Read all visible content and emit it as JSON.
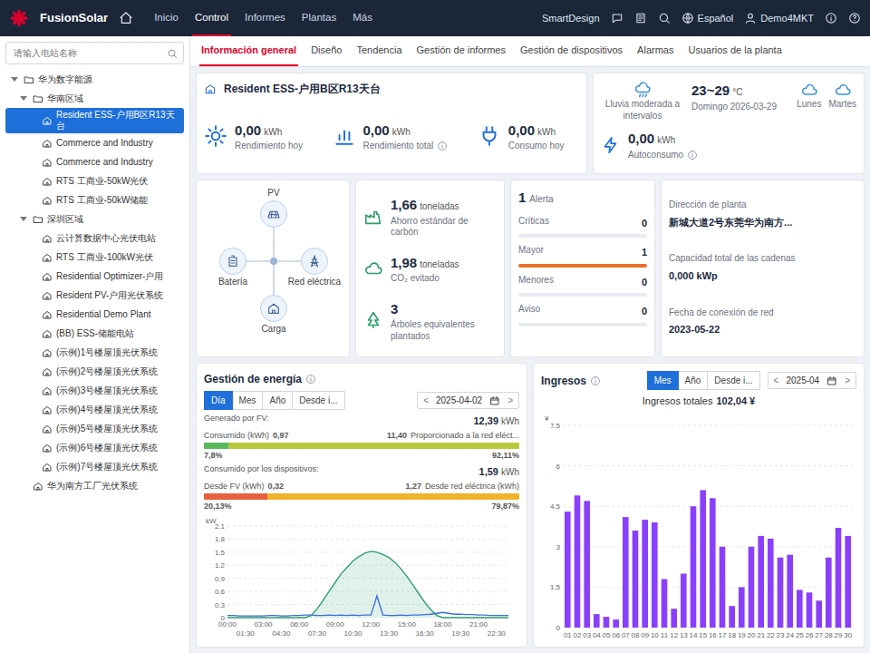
{
  "topbar": {
    "brand": "FusionSolar",
    "menu": [
      {
        "label": "Inicio",
        "selected": false
      },
      {
        "label": "Control",
        "selected": true
      },
      {
        "label": "Informes",
        "selected": false
      },
      {
        "label": "Plantas",
        "selected": false
      },
      {
        "label": "Más",
        "selected": false
      }
    ],
    "smartdesign": "SmartDesign",
    "language": "Español",
    "user": "Demo4MKT"
  },
  "sidebar": {
    "search_placeholder": "请输入电站名称",
    "items": [
      {
        "label": "华为数字能源",
        "depth": 0,
        "kind": "group",
        "expanded": true,
        "selected": false
      },
      {
        "label": "华南区域",
        "depth": 1,
        "kind": "group",
        "expanded": true,
        "selected": false
      },
      {
        "label": "Resident ESS-户用B区R13天台",
        "depth": 2,
        "kind": "plant",
        "selected": true
      },
      {
        "label": "Commerce and Industry",
        "depth": 2,
        "kind": "plant",
        "selected": false
      },
      {
        "label": "Commerce and Industry",
        "depth": 2,
        "kind": "plant",
        "selected": false
      },
      {
        "label": "RTS 工商业-50kW光伏",
        "depth": 2,
        "kind": "plant",
        "selected": false
      },
      {
        "label": "RTS 工商业-50kW储能",
        "depth": 2,
        "kind": "plant",
        "selected": false
      },
      {
        "label": "深圳区域",
        "depth": 1,
        "kind": "group",
        "expanded": true,
        "selected": false
      },
      {
        "label": "云计算数据中心光伏电站",
        "depth": 2,
        "kind": "plant",
        "selected": false
      },
      {
        "label": "RTS 工商业-100kW光伏",
        "depth": 2,
        "kind": "plant",
        "selected": false
      },
      {
        "label": "Residential Optimizer-户用",
        "depth": 2,
        "kind": "plant",
        "selected": false
      },
      {
        "label": "Resident PV-户用光伏系统",
        "depth": 2,
        "kind": "plant",
        "selected": false
      },
      {
        "label": "Residential Demo Plant",
        "depth": 2,
        "kind": "plant",
        "selected": false
      },
      {
        "label": "(BB) ESS-储能电站",
        "depth": 2,
        "kind": "plant",
        "selected": false
      },
      {
        "label": "(示例)1号楼屋顶光伏系统",
        "depth": 2,
        "kind": "plant",
        "selected": false
      },
      {
        "label": "(示例)2号楼屋顶光伏系统",
        "depth": 2,
        "kind": "plant",
        "selected": false
      },
      {
        "label": "(示例)3号楼屋顶光伏系统",
        "depth": 2,
        "kind": "plant",
        "selected": false
      },
      {
        "label": "(示例)4号楼屋顶光伏系统",
        "depth": 2,
        "kind": "plant",
        "selected": false
      },
      {
        "label": "(示例)5号楼屋顶光伏系统",
        "depth": 2,
        "kind": "plant",
        "selected": false
      },
      {
        "label": "(示例)6号楼屋顶光伏系统",
        "depth": 2,
        "kind": "plant",
        "selected": false
      },
      {
        "label": "(示例)7号楼屋顶光伏系统",
        "depth": 2,
        "kind": "plant",
        "selected": false
      },
      {
        "label": "华为南方工厂光伏系统",
        "depth": 1,
        "kind": "plant",
        "selected": false
      }
    ]
  },
  "tabs": [
    {
      "label": "Información general",
      "selected": true
    },
    {
      "label": "Diseño",
      "selected": false
    },
    {
      "label": "Tendencia",
      "selected": false
    },
    {
      "label": "Gestión de informes",
      "selected": false
    },
    {
      "label": "Gestión de dispositivos",
      "selected": false
    },
    {
      "label": "Alarmas",
      "selected": false
    },
    {
      "label": "Usuarios de la planta",
      "selected": false
    }
  ],
  "plant": {
    "name": "Resident ESS-户用B区R13天台",
    "kpis": [
      {
        "value": "0,00",
        "unit": "kWh",
        "label": "Rendimiento hoy"
      },
      {
        "value": "0,00",
        "unit": "kWh",
        "label": "Rendimiento total"
      },
      {
        "value": "0,00",
        "unit": "kWh",
        "label": "Consumo hoy"
      }
    ]
  },
  "weather": {
    "description": "Lluvia moderada a intervalos",
    "temperature": "23~29",
    "temperature_unit": "°C",
    "date": "Domingo 2026-03-29",
    "forecast": [
      "Lunes",
      "Martes"
    ],
    "self_consumption": {
      "value": "0,00",
      "unit": "kWh",
      "label": "Autoconsumo"
    }
  },
  "flow": {
    "nodes": [
      "PV",
      "Batería",
      "Red eléctrica",
      "Carga"
    ]
  },
  "environment": [
    {
      "value": "1,66",
      "unit": "toneladas",
      "label": "Ahorro estándar de carbón"
    },
    {
      "value": "1,98",
      "unit": "toneladas",
      "label": "CO₂ evitado"
    },
    {
      "value": "3",
      "unit": "",
      "label": "Árboles equivalentes plantados"
    }
  ],
  "alarms": {
    "total": "1",
    "label": "Alerta",
    "levels": [
      {
        "label": "Críticas",
        "count": "0",
        "level": 0,
        "color": "#e02b2b"
      },
      {
        "label": "Mayor",
        "count": "1",
        "level": 1,
        "color": "#e8702a"
      },
      {
        "label": "Menores",
        "count": "0",
        "level": 0,
        "color": "#f5b400"
      },
      {
        "label": "Aviso",
        "count": "0",
        "level": 0,
        "color": "#3b82f6"
      }
    ]
  },
  "plant_info": [
    {
      "label": "Dirección de planta",
      "value": "新城大道2号东莞华为南方..."
    },
    {
      "label": "Capacidad total de las cadenas",
      "value": "0,000 kWp"
    },
    {
      "label": "Fecha de conexión de red",
      "value": "2023-05-22"
    }
  ],
  "energy": {
    "title": "Gestión de energía",
    "periods": [
      {
        "label": "Día",
        "selected": true
      },
      {
        "label": "Mes",
        "selected": false
      },
      {
        "label": "Año",
        "selected": false
      },
      {
        "label": "Desde i...",
        "selected": false
      }
    ],
    "picker": {
      "prev": "<",
      "date": "2025-04-02",
      "next": ">"
    },
    "sections": [
      {
        "label": "Generado por FV:",
        "value": "12,39",
        "unit": "kWh",
        "left_label": "Consumido (kWh)",
        "left_value": "0,97",
        "right_label": "Proporcionado a la red eléct...",
        "right_value": "11,40",
        "segments": [
          {
            "text": "7,8%",
            "level": 0.0787,
            "color": "#5cb85c"
          },
          {
            "text": "92,11%",
            "level": 0.9211,
            "color": "#b7c93b"
          }
        ]
      },
      {
        "label": "Consumido por los dispositivos:",
        "value": "1,59",
        "unit": "kWh",
        "left_label": "Desde FV (kWh)",
        "left_value": "0,32",
        "right_label": "Desde red eléctrica (kWh)",
        "right_value": "1,27",
        "segments": [
          {
            "text": "20,13%",
            "level": 0.2013,
            "color": "#e8613c"
          },
          {
            "text": "79,87%",
            "level": 0.7987,
            "color": "#f0b429"
          }
        ]
      }
    ],
    "chart": {
      "unit": "kW",
      "y_max": 2.1,
      "y_ticks": [
        "2.1",
        "1.8",
        "1.5",
        "1.2",
        "0.9",
        "0.6",
        "0.3",
        "0"
      ],
      "x_ticks": [
        "00:00",
        "01:30",
        "03:00",
        "04:30",
        "06:00",
        "07:30",
        "09:00",
        "10:30",
        "12:00",
        "13:30",
        "15:00",
        "16:30",
        "18:00",
        "19:30",
        "21:00",
        "22:30"
      ],
      "series": [
        {
          "color": "#2e9e6a",
          "values": [
            0,
            0,
            0,
            0,
            0,
            0,
            0,
            0,
            0,
            0,
            0,
            0,
            0,
            0,
            0.05,
            0.2,
            0.4,
            0.6,
            0.8,
            1.0,
            1.15,
            1.3,
            1.4,
            1.48,
            1.52,
            1.5,
            1.45,
            1.38,
            1.27,
            1.12,
            0.95,
            0.75,
            0.55,
            0.35,
            0.18,
            0.05,
            0,
            0,
            0,
            0,
            0,
            0,
            0,
            0,
            0,
            0,
            0,
            0
          ]
        },
        {
          "color": "#3b6fd9",
          "values": [
            0.05,
            0.05,
            0.04,
            0.04,
            0.04,
            0.04,
            0.04,
            0.05,
            0.05,
            0.04,
            0.04,
            0.05,
            0.05,
            0.06,
            0.06,
            0.05,
            0.05,
            0.06,
            0.05,
            0.06,
            0.05,
            0.06,
            0.05,
            0.06,
            0.06,
            0.5,
            0.06,
            0.05,
            0.05,
            0.06,
            0.05,
            0.06,
            0.06,
            0.07,
            0.08,
            0.1,
            0.12,
            0.1,
            0.08,
            0.08,
            0.07,
            0.07,
            0.06,
            0.06,
            0.05,
            0.05,
            0.05,
            0.05
          ]
        }
      ]
    }
  },
  "income": {
    "title": "Ingresos",
    "periods": [
      {
        "label": "Mes",
        "selected": true
      },
      {
        "label": "Año",
        "selected": false
      },
      {
        "label": "Desde i...",
        "selected": false
      }
    ],
    "picker": {
      "prev": "<",
      "date": "2025-04",
      "next": ">"
    },
    "total_label": "Ingresos totales",
    "total_value": "102,04 ¥",
    "chart": {
      "unit": "¥",
      "y_max": 7.5,
      "y_ticks": [
        "7.5",
        "6",
        "4.5",
        "3",
        "1.5",
        "0"
      ],
      "color": "#8a3ffc",
      "labels": [
        "01",
        "02",
        "03",
        "04",
        "05",
        "06",
        "07",
        "08",
        "09",
        "10",
        "11",
        "12",
        "13",
        "14",
        "15",
        "16",
        "17",
        "18",
        "19",
        "20",
        "21",
        "22",
        "23",
        "24",
        "25",
        "26",
        "27",
        "28",
        "29",
        "30"
      ],
      "values": [
        4.3,
        4.9,
        4.7,
        0.5,
        0.4,
        0.3,
        4.1,
        3.6,
        4.0,
        3.9,
        1.8,
        0.7,
        2.0,
        4.5,
        5.1,
        4.8,
        3.0,
        0.8,
        1.5,
        3.0,
        3.4,
        3.3,
        2.6,
        2.7,
        1.4,
        1.3,
        1.0,
        2.6,
        3.7,
        3.4
      ]
    }
  }
}
